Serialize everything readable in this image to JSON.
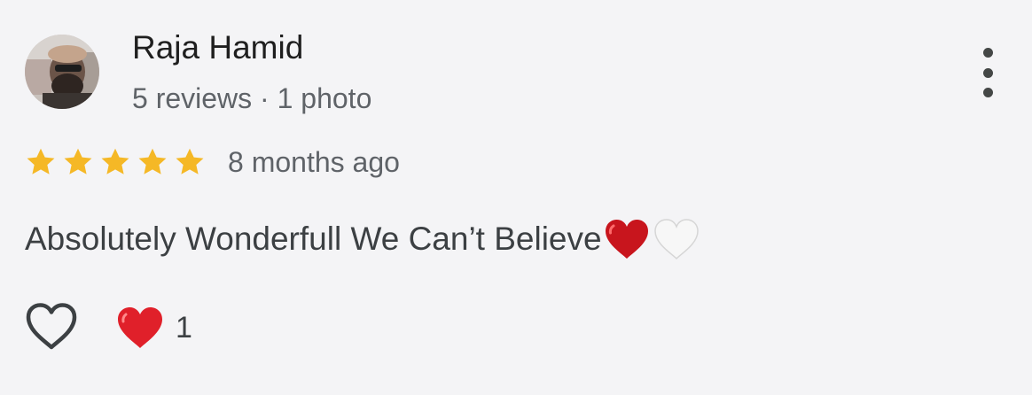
{
  "reviewer": {
    "name": "Raja Hamid",
    "meta": "5 reviews · 1 photo"
  },
  "rating": {
    "stars": 5,
    "max_stars": 5,
    "time": "8 months ago",
    "star_color": "#f5b826"
  },
  "review": {
    "text": "Absolutely Wonderfull We Can’t Believe",
    "emojis": [
      "red-heart-emoji",
      "white-heart-emoji"
    ]
  },
  "actions": {
    "like_icon": "heart-outline-icon",
    "reaction_icon": "red-heart-emoji",
    "reaction_count": "1"
  },
  "menu": {
    "icon": "more-vertical-icon"
  },
  "colors": {
    "background": "#f4f4f6",
    "heart_red": "#e0202a",
    "secondary_text": "#5f6368"
  }
}
